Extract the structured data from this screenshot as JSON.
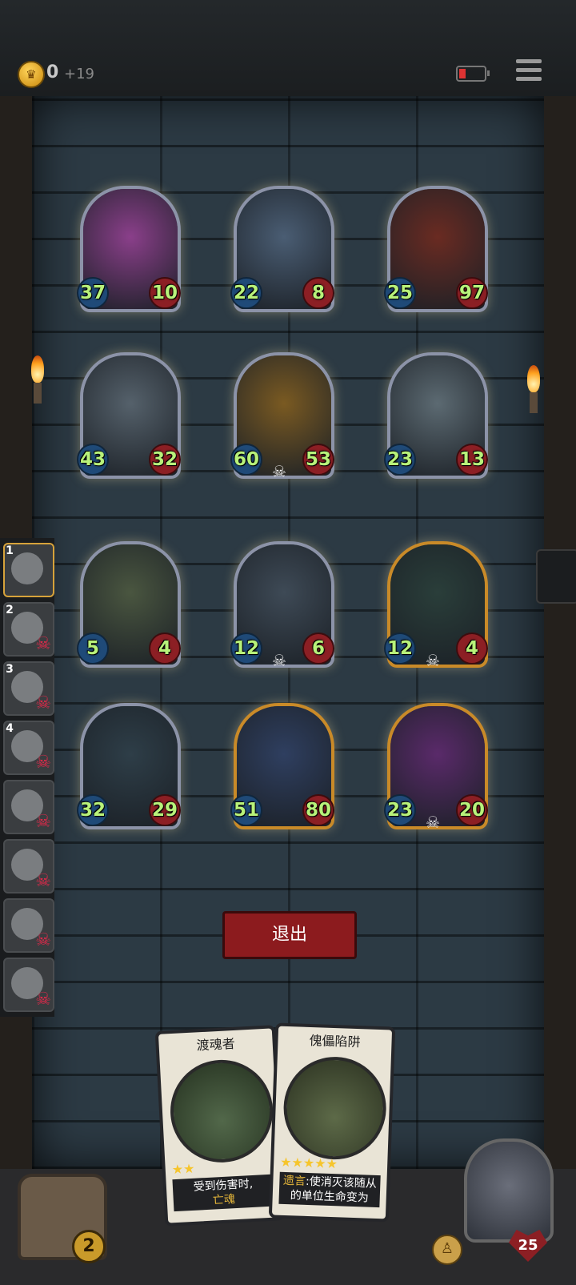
{
  "header": {
    "gold": "0",
    "gold_income": "+19",
    "coin_icon": "crown-coin-icon",
    "battery_icon": "battery-low-icon",
    "menu_icon": "menu-icon"
  },
  "board": {
    "units": [
      {
        "atk": "37",
        "hp": "10",
        "frame": "silver",
        "tint": "#8a3f8a"
      },
      {
        "atk": "22",
        "hp": "8",
        "frame": "silver",
        "tint": "#4a5d73"
      },
      {
        "atk": "25",
        "hp": "97",
        "frame": "silver",
        "tint": "#6a2b22"
      },
      {
        "atk": "43",
        "hp": "32",
        "frame": "silver",
        "tint": "#55616b"
      },
      {
        "atk": "60",
        "hp": "53",
        "frame": "silver",
        "tint": "#7a5a22"
      },
      {
        "atk": "23",
        "hp": "13",
        "frame": "silver",
        "tint": "#5c6a72"
      },
      {
        "atk": "5",
        "hp": "4",
        "frame": "silver",
        "tint": "#4a5640"
      },
      {
        "atk": "12",
        "hp": "6",
        "frame": "silver",
        "tint": "#3e4a56"
      },
      {
        "atk": "12",
        "hp": "4",
        "frame": "gold",
        "tint": "#2a3e3a"
      },
      {
        "atk": "32",
        "hp": "29",
        "frame": "silver",
        "tint": "#2e3e48"
      },
      {
        "atk": "51",
        "hp": "80",
        "frame": "gold",
        "tint": "#2f3f60"
      },
      {
        "atk": "23",
        "hp": "20",
        "frame": "gold",
        "tint": "#5a2a6a"
      }
    ]
  },
  "queue": {
    "slots": [
      {
        "num": "1",
        "active": true
      },
      {
        "num": "2"
      },
      {
        "num": "3"
      },
      {
        "num": "4"
      },
      {
        "num": ""
      },
      {
        "num": ""
      },
      {
        "num": ""
      },
      {
        "num": ""
      }
    ]
  },
  "exit_button": "退出",
  "chest_count": "2",
  "hand": [
    {
      "title": "渡魂者",
      "stars": "★★",
      "text": "受到伤害时,",
      "keyword": "亡魂"
    },
    {
      "title": "傀儡陷阱",
      "stars": "★★★★★",
      "keyword_prefix": "遗言",
      "text": ":使消灭该随从的单位生命变为"
    }
  ],
  "hero_hp": "25"
}
